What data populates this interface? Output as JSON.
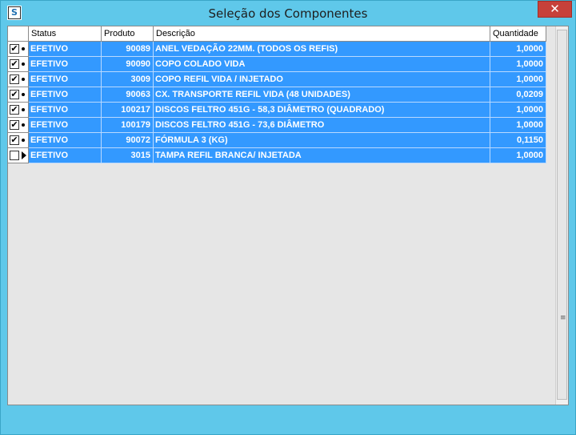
{
  "window": {
    "title": "Seleção dos Componentes",
    "app_icon_text": "S",
    "close_glyph": "✕"
  },
  "grid": {
    "columns": [
      "Status",
      "Produto",
      "Descrição",
      "Quantidade"
    ],
    "rows": [
      {
        "checked": true,
        "status": "EFETIVO",
        "produto": "90089",
        "descricao": "ANEL VEDAÇÃO 22MM. (TODOS OS REFIS)",
        "quantidade": "1,0000"
      },
      {
        "checked": true,
        "status": "EFETIVO",
        "produto": "90090",
        "descricao": "COPO COLADO VIDA",
        "quantidade": "1,0000"
      },
      {
        "checked": true,
        "status": "EFETIVO",
        "produto": "3009",
        "descricao": "COPO REFIL VIDA / INJETADO",
        "quantidade": "1,0000"
      },
      {
        "checked": true,
        "status": "EFETIVO",
        "produto": "90063",
        "descricao": "CX. TRANSPORTE REFIL VIDA (48 UNIDADES)",
        "quantidade": "0,0209"
      },
      {
        "checked": true,
        "status": "EFETIVO",
        "produto": "100217",
        "descricao": "DISCOS FELTRO 451G - 58,3 DIÂMETRO (QUADRADO)",
        "quantidade": "1,0000"
      },
      {
        "checked": true,
        "status": "EFETIVO",
        "produto": "100179",
        "descricao": "DISCOS FELTRO 451G - 73,6 DIÂMETRO",
        "quantidade": "1,0000"
      },
      {
        "checked": true,
        "status": "EFETIVO",
        "produto": "90072",
        "descricao": "FÓRMULA 3 (KG)",
        "quantidade": "0,1150"
      },
      {
        "checked": false,
        "current": true,
        "status": "EFETIVO",
        "produto": "3015",
        "descricao": "TAMPA REFIL BRANCA/ INJETADA",
        "quantidade": "1,0000"
      }
    ]
  },
  "scrollbar": {
    "grip_glyph": "≡"
  },
  "colors": {
    "selection": "#3399ff",
    "chrome": "#5fc8ea",
    "close": "#c7413a"
  }
}
